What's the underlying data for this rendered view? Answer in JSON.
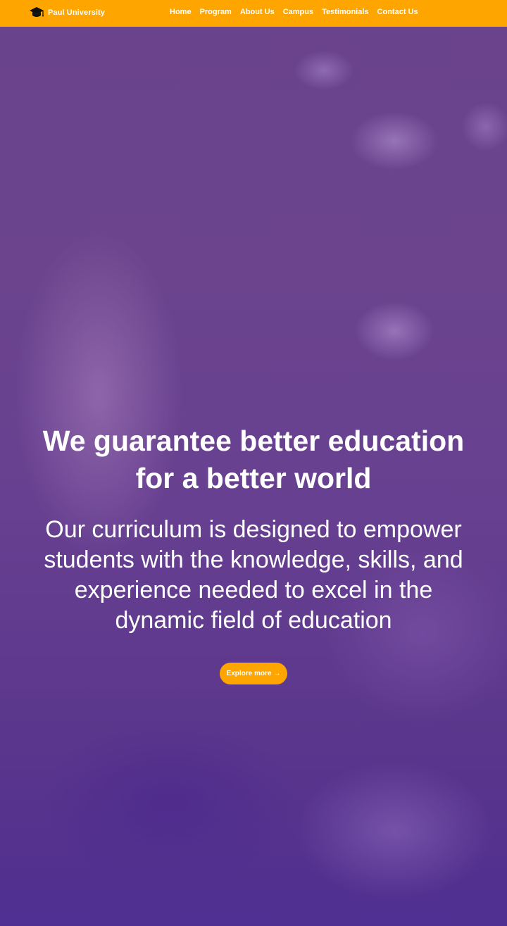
{
  "brand": {
    "name": "Paul University",
    "icon": "graduation-cap-icon"
  },
  "nav": {
    "items": [
      {
        "label": "Home"
      },
      {
        "label": "Program"
      },
      {
        "label": "About Us"
      },
      {
        "label": "Campus"
      },
      {
        "label": "Testimonials"
      },
      {
        "label": "Contact Us"
      }
    ]
  },
  "hero": {
    "title_line1": "We guarantee better education",
    "title_line2": "for a better world",
    "subtitle_line1": "Our curriculum is designed to empower",
    "subtitle_line2": "students with the knowledge, skills, and",
    "subtitle_line3": "experience needed to excel in the",
    "subtitle_line4": "dynamic field of education",
    "cta_label": "Explore more",
    "cta_arrow": "→"
  },
  "colors": {
    "accent": "#ffa500",
    "text": "#ffffff",
    "overlay": "#6a3fa0"
  }
}
